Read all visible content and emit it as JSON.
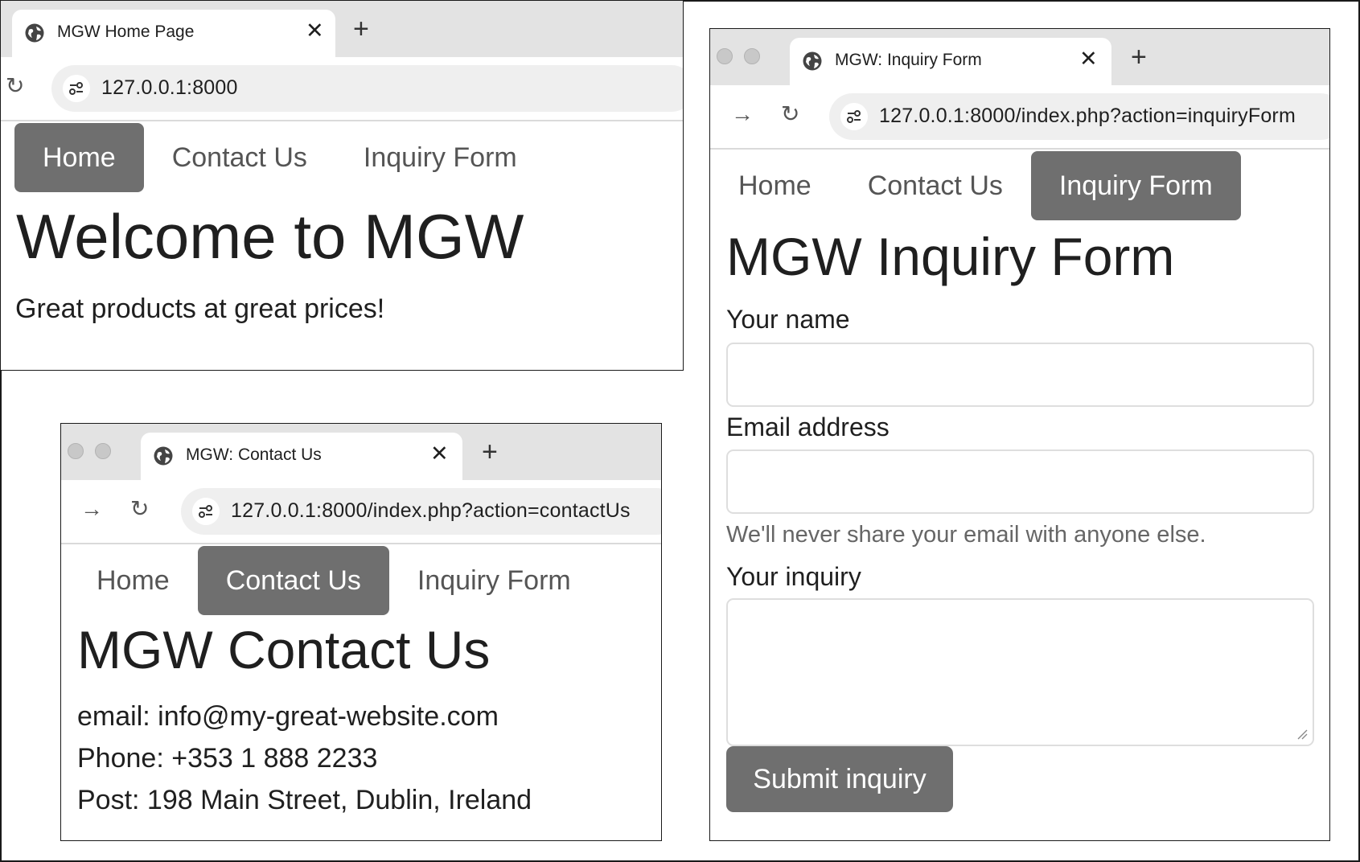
{
  "home_window": {
    "tab_title": "MGW Home Page",
    "url": "127.0.0.1:8000",
    "nav": [
      "Home",
      "Contact Us",
      "Inquiry Form"
    ],
    "active_nav": "Home",
    "heading": "Welcome to MGW",
    "tagline": "Great products at great prices!"
  },
  "contact_window": {
    "tab_title": "MGW: Contact Us",
    "url": "127.0.0.1:8000/index.php?action=contactUs",
    "nav": [
      "Home",
      "Contact Us",
      "Inquiry Form"
    ],
    "active_nav": "Contact Us",
    "heading": "MGW Contact Us",
    "lines": [
      "email: info@my-great-website.com",
      "Phone: +353 1 888 2233",
      "Post: 198 Main Street, Dublin, Ireland"
    ]
  },
  "inquiry_window": {
    "tab_title": "MGW: Inquiry Form",
    "url": "127.0.0.1:8000/index.php?action=inquiryForm",
    "nav": [
      "Home",
      "Contact Us",
      "Inquiry Form"
    ],
    "active_nav": "Inquiry Form",
    "heading": "MGW Inquiry Form",
    "form": {
      "name_label": "Your name",
      "name_value": "",
      "email_label": "Email address",
      "email_value": "",
      "email_help": "We'll never share your email with anyone else.",
      "inquiry_label": "Your inquiry",
      "inquiry_value": "",
      "submit_label": "Submit inquiry"
    }
  },
  "icons": {
    "tab_icon": "globe-icon",
    "close_tab": "close-icon",
    "new_tab": "plus-icon",
    "back": "arrow-right-icon",
    "reload": "reload-icon",
    "site_settings": "tune-icon"
  },
  "colors": {
    "active_nav_bg": "#6f6f6f",
    "tab_strip": "#e3e3e3",
    "omnibox": "#efefef"
  }
}
